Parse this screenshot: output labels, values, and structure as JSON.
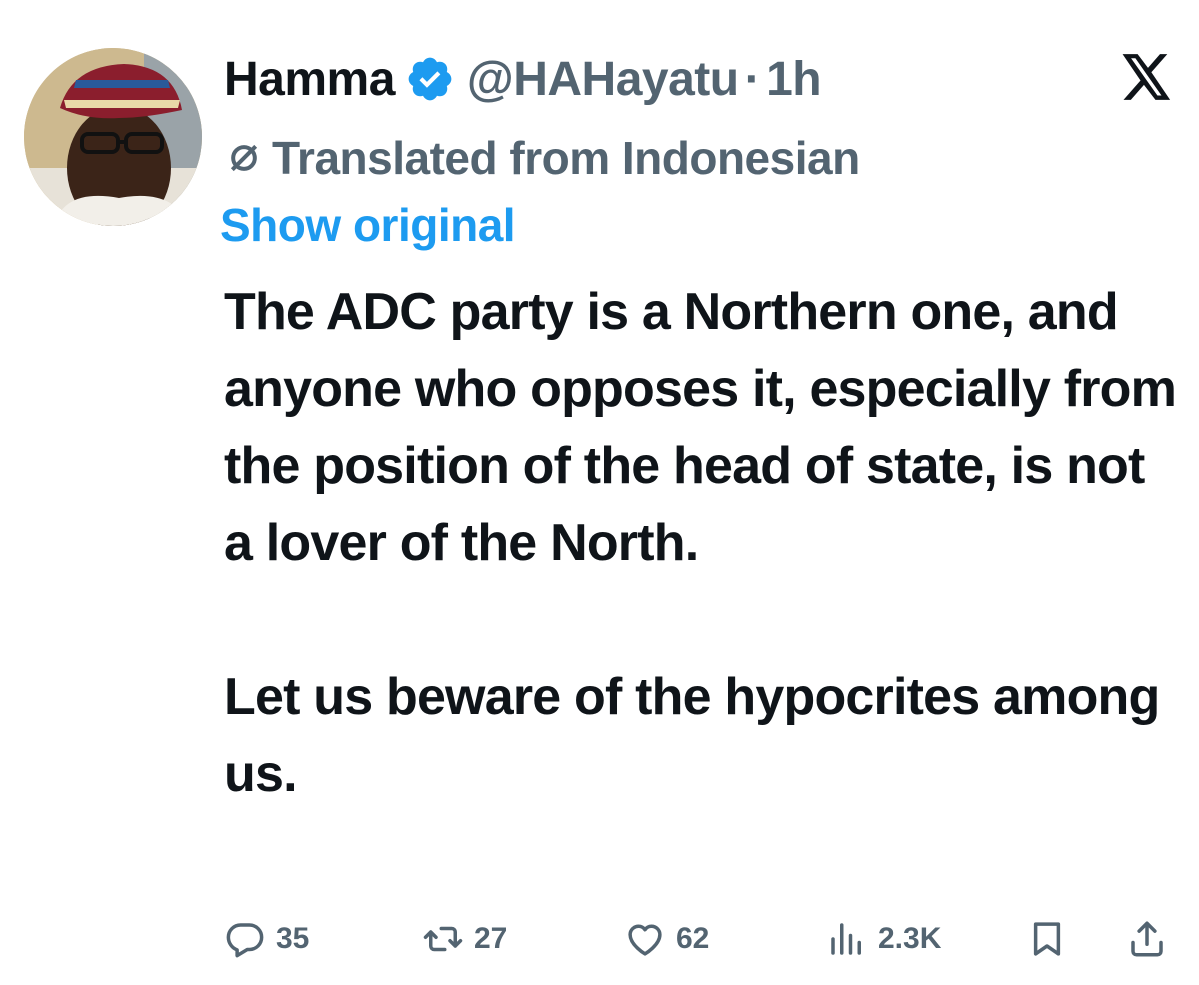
{
  "tweet": {
    "author_name": "Hamma",
    "handle": "@HAHayatu",
    "separator": "·",
    "time": "1h",
    "translated_label": "Translated from Indonesian",
    "show_original_label": "Show original",
    "paragraphs": [
      "The ADC party is a Northern one, and anyone who opposes it, especially from the position of the head of state, is not a lover of the North.",
      "Let us beware of the hypocrites among us."
    ]
  },
  "actions": {
    "replies": "35",
    "reposts": "27",
    "likes": "62",
    "views": "2.3K"
  },
  "icons": {
    "verified": "verified-badge-icon",
    "x_logo": "x-logo-icon",
    "translate": "translate-icon",
    "reply": "reply-icon",
    "repost": "repost-icon",
    "like": "heart-icon",
    "views": "views-icon",
    "bookmark": "bookmark-icon",
    "share": "share-icon"
  },
  "colors": {
    "text": "#0f1419",
    "secondary": "#536471",
    "accent": "#1d9bf0"
  }
}
